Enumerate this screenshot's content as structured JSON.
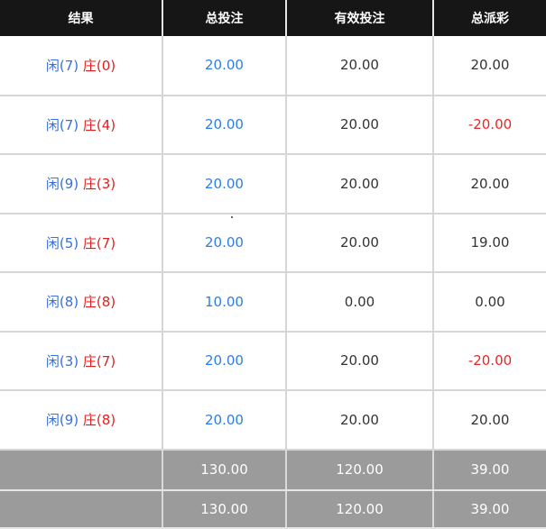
{
  "headers": {
    "result": "结果",
    "total_bet": "总投注",
    "valid_bet": "有效投注",
    "total_payout": "总派彩"
  },
  "player_label": "闲",
  "banker_label": "庄",
  "rows": [
    {
      "player": "(7)",
      "banker": "(0)",
      "total_bet": "20.00",
      "valid_bet": "20.00",
      "payout": "20.00",
      "payout_color": "#333333"
    },
    {
      "player": "(7)",
      "banker": "(4)",
      "total_bet": "20.00",
      "valid_bet": "20.00",
      "payout": "-20.00",
      "payout_color": "#ee2222"
    },
    {
      "player": "(9)",
      "banker": "(3)",
      "total_bet": "20.00",
      "valid_bet": "20.00",
      "payout": "20.00",
      "payout_color": "#333333"
    },
    {
      "player": "(5)",
      "banker": "(7)",
      "total_bet": "20.00",
      "valid_bet": "20.00",
      "payout": "19.00",
      "payout_color": "#333333"
    },
    {
      "player": "(8)",
      "banker": "(8)",
      "total_bet": "10.00",
      "valid_bet": "0.00",
      "payout": "0.00",
      "payout_color": "#333333"
    },
    {
      "player": "(3)",
      "banker": "(7)",
      "total_bet": "20.00",
      "valid_bet": "20.00",
      "payout": "-20.00",
      "payout_color": "#ee2222"
    },
    {
      "player": "(9)",
      "banker": "(8)",
      "total_bet": "20.00",
      "valid_bet": "20.00",
      "payout": "20.00",
      "payout_color": "#333333"
    }
  ],
  "totals": [
    {
      "label": "",
      "total_bet": "130.00",
      "valid_bet": "120.00",
      "payout": "39.00"
    },
    {
      "label": "",
      "total_bet": "130.00",
      "valid_bet": "120.00",
      "payout": "39.00"
    }
  ],
  "colors": {
    "header_bg": "#161616",
    "player": "#3a6fd8",
    "banker": "#e02020",
    "bet_blue": "#2f7de1",
    "negative": "#ee2222",
    "total_bg": "#9b9b9b"
  }
}
